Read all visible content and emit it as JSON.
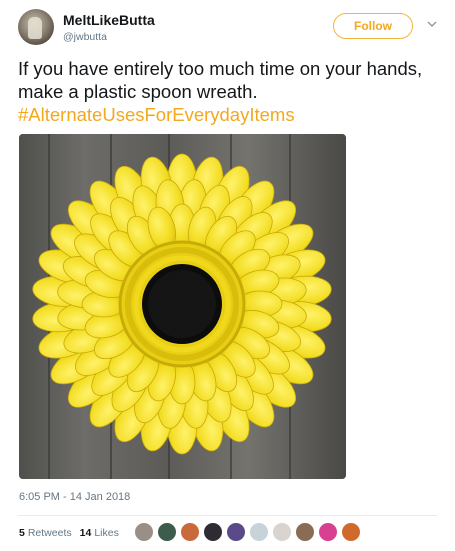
{
  "user": {
    "name": "MeltLikeButta",
    "handle": "@jwbutta"
  },
  "follow_label": "Follow",
  "tweet": {
    "text": "If you have entirely too much time on your hands, make a plastic spoon wreath.",
    "hashtag": "#AlternateUsesForEverydayItems"
  },
  "timestamp": "6:05 PM - 14 Jan 2018",
  "stats": {
    "retweets_count": "5",
    "retweets_label": "Retweets",
    "likes_count": "14",
    "likes_label": "Likes"
  },
  "colors": {
    "accent": "#f3a81e",
    "muted": "#657786",
    "spoon_yellow": "#f2dc1f",
    "liker_colors": [
      "#9a8f86",
      "#3d5c4c",
      "#c96a3b",
      "#2f2b33",
      "#5a4a8a",
      "#c7d3d9",
      "#d9d4cf",
      "#8a6b53",
      "#d9408f",
      "#d06a2c"
    ]
  },
  "icons": {
    "caret": "chevron-down-icon"
  }
}
